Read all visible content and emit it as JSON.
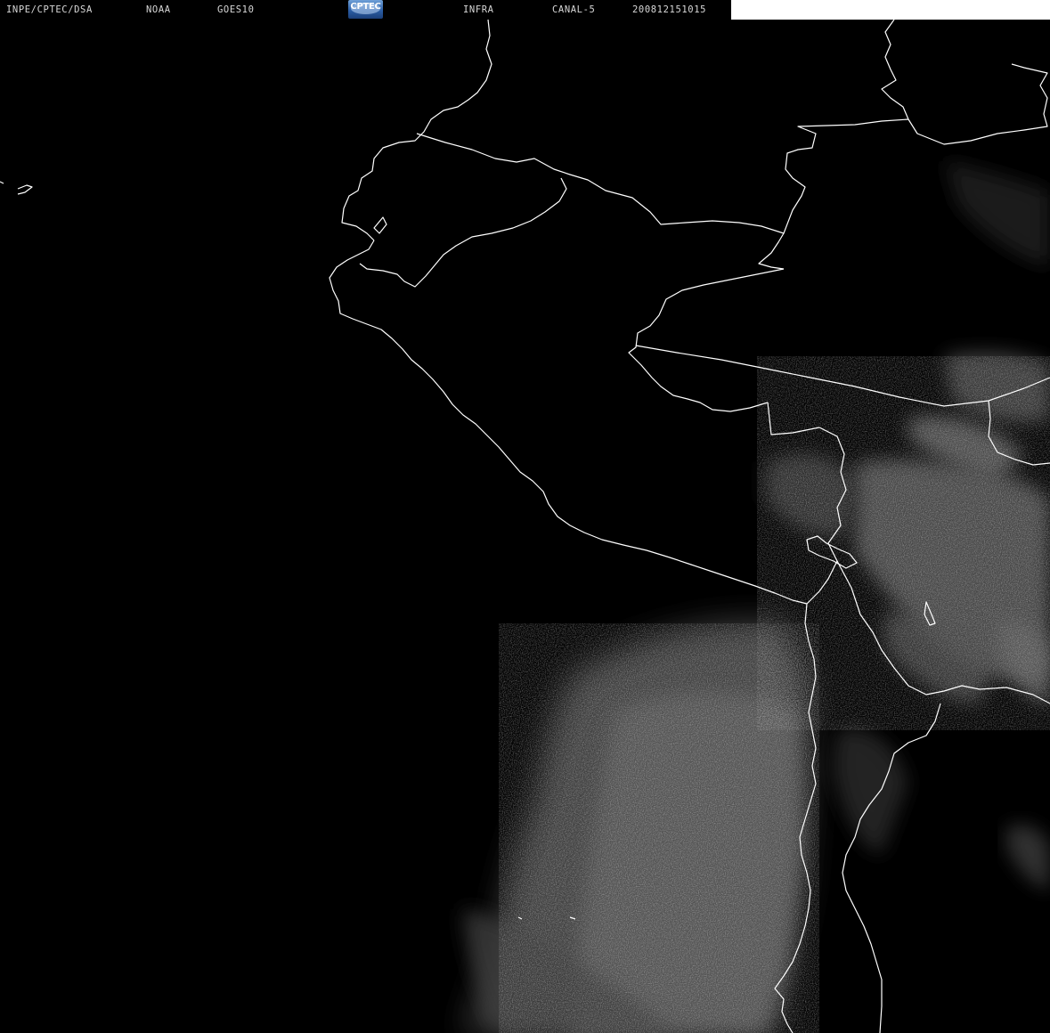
{
  "header": {
    "institution": "INPE/CPTEC/DSA",
    "agency": "NOAA",
    "satellite": "GOES10",
    "logo_text": "CPTEC",
    "product": "INFRA",
    "channel": "CANAL-5",
    "timestamp": "200812151015"
  },
  "colors": {
    "background": "#000000",
    "header_text": "#d8d8d8",
    "coastline": "#ffffff",
    "header_blank": "#ffffff",
    "cloud": "#9a9a9a",
    "logo": "#2c5fa6"
  },
  "icons": {
    "logo": "cptec-logo-icon"
  }
}
